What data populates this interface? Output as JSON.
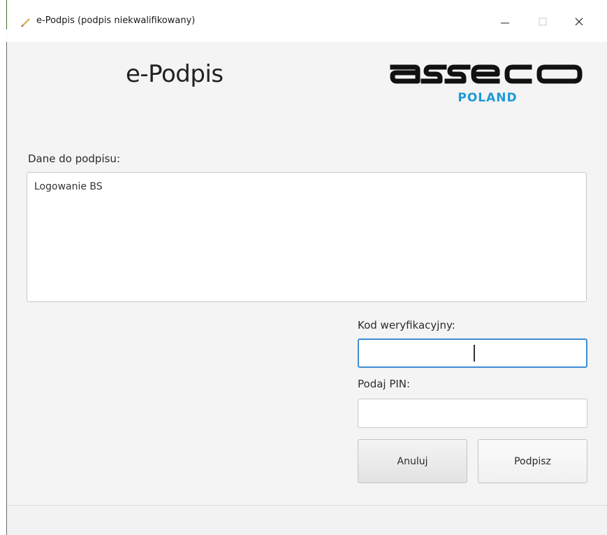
{
  "window": {
    "title": "e-Podpis (podpis niekwalifikowany)",
    "icon": "pen-icon"
  },
  "header": {
    "app_title": "e-Podpis",
    "logo_text": "asseco",
    "logo_sub": "POLAND",
    "logo_color": "#1e9ad6"
  },
  "sign_data": {
    "label": "Dane do podpisu:",
    "value": "Logowanie BS"
  },
  "form": {
    "code_label": "Kod weryfikacyjny:",
    "code_value": "",
    "pin_label": "Podaj PIN:",
    "pin_value": ""
  },
  "buttons": {
    "cancel_label": "Anuluj",
    "sign_label": "Podpisz"
  },
  "colors": {
    "focus_border": "#3d8ed4",
    "window_accent": "#3f6e2a"
  }
}
